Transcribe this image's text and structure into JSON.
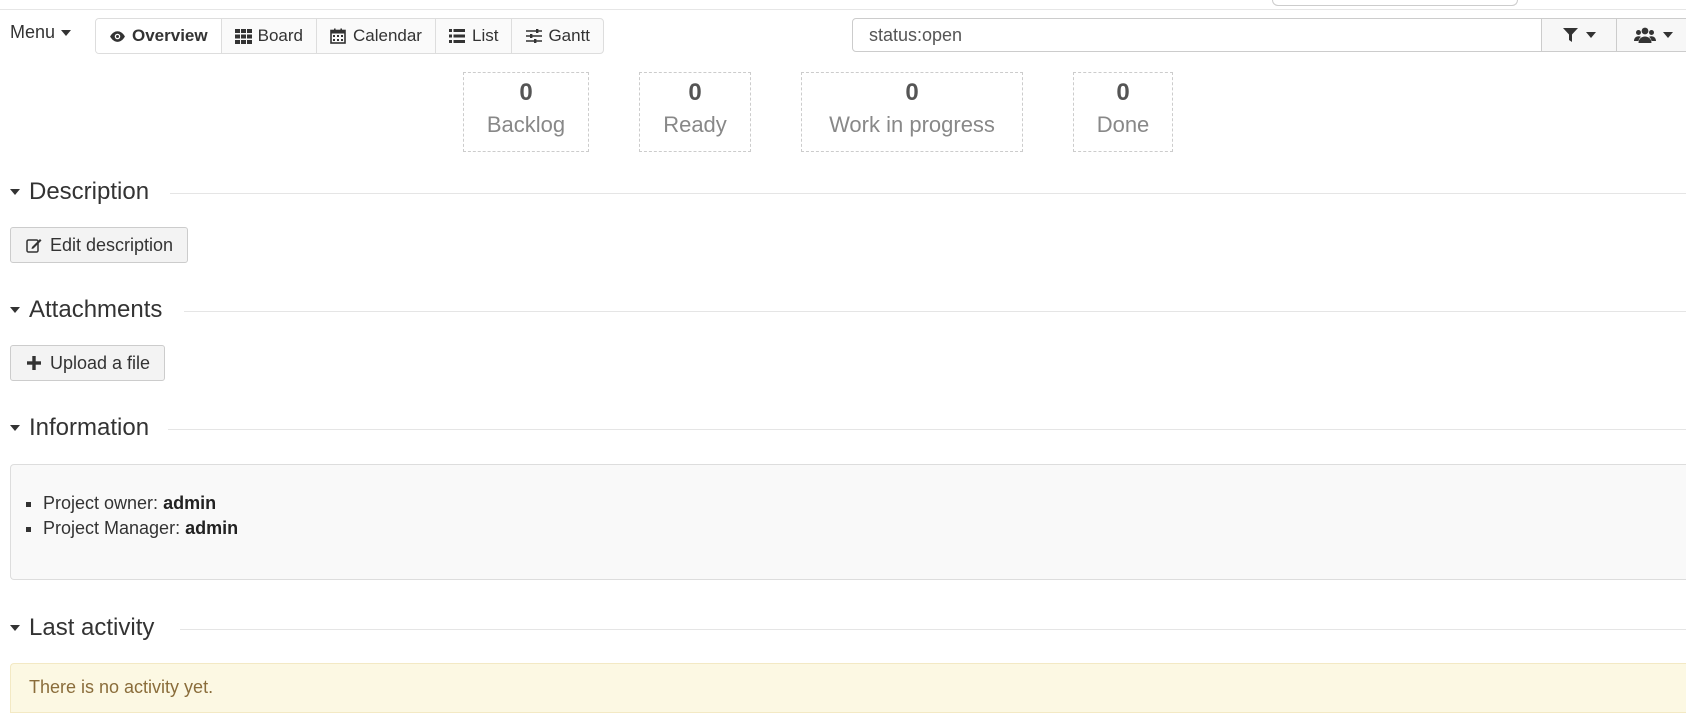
{
  "menu": {
    "label": "Menu"
  },
  "views": [
    {
      "label": "Overview",
      "icon": "eye-icon",
      "active": true
    },
    {
      "label": "Board",
      "icon": "board-grid-icon",
      "active": false
    },
    {
      "label": "Calendar",
      "icon": "calendar-icon",
      "active": false
    },
    {
      "label": "List",
      "icon": "list-icon",
      "active": false
    },
    {
      "label": "Gantt",
      "icon": "sliders-icon",
      "active": false
    }
  ],
  "search": {
    "value": "status:open",
    "placeholder": ""
  },
  "columns": [
    {
      "count": "0",
      "label": "Backlog"
    },
    {
      "count": "0",
      "label": "Ready"
    },
    {
      "count": "0",
      "label": "Work in progress"
    },
    {
      "count": "0",
      "label": "Done"
    }
  ],
  "sections": {
    "description": {
      "title": "Description",
      "button": "Edit description"
    },
    "attachments": {
      "title": "Attachments",
      "button": "Upload a file"
    },
    "information": {
      "title": "Information",
      "items": [
        {
          "label": "Project owner:",
          "value": "admin"
        },
        {
          "label": "Project Manager:",
          "value": "admin"
        }
      ]
    },
    "activity": {
      "title": "Last activity",
      "empty_message": "There is no activity yet."
    }
  },
  "colors": {
    "alert_bg": "#fcf8e3",
    "alert_text": "#8a6d3b",
    "panel_bg": "#f9f9f9"
  }
}
